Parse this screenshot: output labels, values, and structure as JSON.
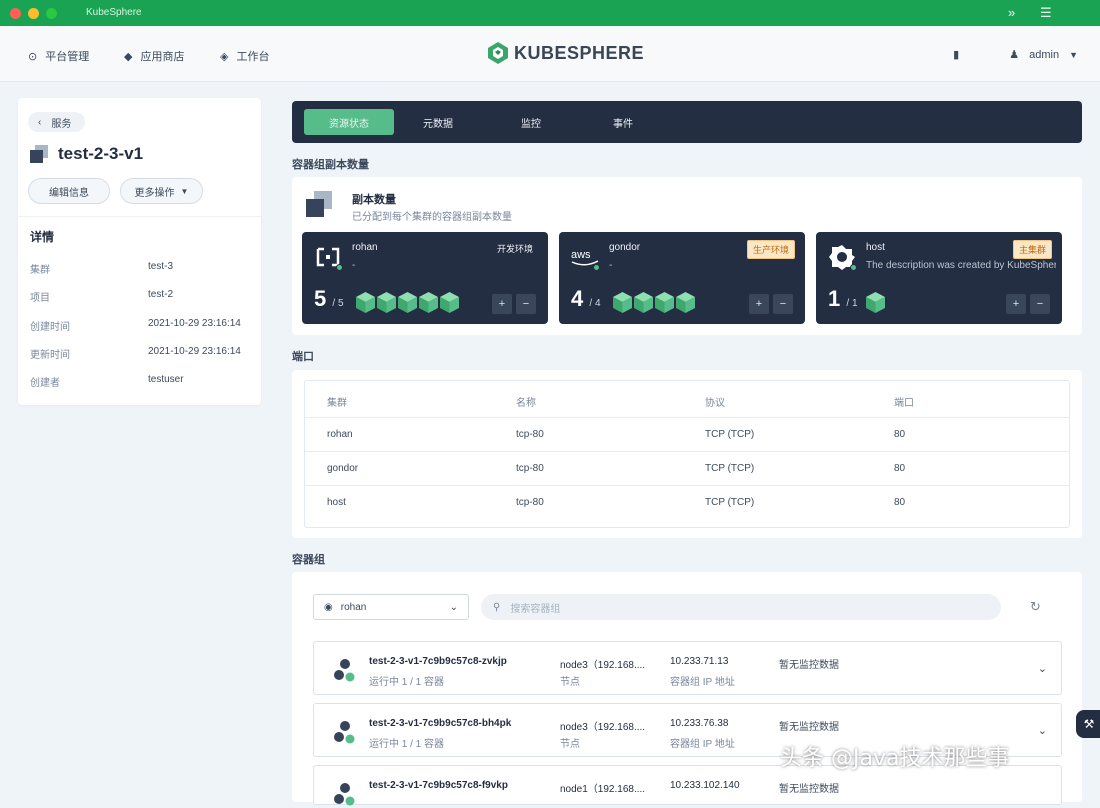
{
  "window": {
    "title": "KubeSphere",
    "colors": {
      "titlebar": "#1aa352",
      "close": "#ff5f57",
      "minimize": "#febc2e",
      "maximize": "#28c840"
    }
  },
  "topnav": {
    "items": [
      {
        "label": "平台管理",
        "icon": "platform-icon"
      },
      {
        "label": "应用商店",
        "icon": "appstore-icon"
      },
      {
        "label": "工作台",
        "icon": "workbench-icon"
      }
    ],
    "logo_text": "KUBESPHERE",
    "user": "admin"
  },
  "left": {
    "back_label": "服务",
    "workload_name": "test-2-3-v1",
    "edit_label": "编辑信息",
    "more_label": "更多操作",
    "details_heading": "详情",
    "details": [
      {
        "key": "集群",
        "value": "test-3"
      },
      {
        "key": "项目",
        "value": "test-2"
      },
      {
        "key": "创建时间",
        "value": "2021-10-29 23:16:14"
      },
      {
        "key": "更新时间",
        "value": "2021-10-29 23:16:14"
      },
      {
        "key": "创建者",
        "value": "testuser"
      }
    ]
  },
  "tabs": [
    {
      "label": "资源状态",
      "active": true
    },
    {
      "label": "元数据",
      "active": false
    },
    {
      "label": "监控",
      "active": false
    },
    {
      "label": "事件",
      "active": false
    }
  ],
  "deploy": {
    "section_title": "容器组副本数量",
    "panel_title": "副本数量",
    "panel_desc": "已分配到每个集群的容器组副本数量",
    "clusters": [
      {
        "name": "rohan",
        "desc": "-",
        "tag": "开发环境",
        "tag_style": "dark",
        "running": "5",
        "total": "5",
        "logo": "rohan-cluster-icon",
        "cubes": 5
      },
      {
        "name": "gondor",
        "desc": "-",
        "tag": "生产环境",
        "tag_style": "orange",
        "running": "4",
        "total": "4",
        "logo": "aws-icon",
        "cubes": 4
      },
      {
        "name": "host",
        "desc": "The description was created by KubeSphere",
        "tag": "主集群",
        "tag_style": "orange",
        "running": "1",
        "total": "1",
        "logo": "host-cluster-icon",
        "cubes": 1
      }
    ]
  },
  "ports": {
    "section_title": "端口",
    "headers": [
      "集群",
      "名称",
      "协议",
      "端口"
    ],
    "rows": [
      [
        "rohan",
        "tcp-80",
        "TCP (TCP)",
        "80"
      ],
      [
        "gondor",
        "tcp-80",
        "TCP (TCP)",
        "80"
      ],
      [
        "host",
        "tcp-80",
        "TCP (TCP)",
        "80"
      ]
    ]
  },
  "pods": {
    "section_title": "容器组",
    "cluster_select": "rohan",
    "search_placeholder": "搜索容器组",
    "items": [
      {
        "name": "test-2-3-v1-7c9b9c57c8-zvkjp",
        "status": "运行中 1 / 1 容器",
        "node": "node3（192.168....",
        "node_label": "节点",
        "ip": "10.233.71.13",
        "ip_label": "容器组 IP 地址",
        "metric": "暂无监控数据"
      },
      {
        "name": "test-2-3-v1-7c9b9c57c8-bh4pk",
        "status": "运行中 1 / 1 容器",
        "node": "node3（192.168....",
        "node_label": "节点",
        "ip": "10.233.76.38",
        "ip_label": "容器组 IP 地址",
        "metric": "暂无监控数据"
      },
      {
        "name": "test-2-3-v1-7c9b9c57c8-f9vkp",
        "status": "",
        "node": "node1（192.168....",
        "node_label": "",
        "ip": "10.233.102.140",
        "ip_label": "",
        "metric": "暂无监控数据"
      }
    ]
  },
  "watermark": "头条 @Java技术那些事"
}
